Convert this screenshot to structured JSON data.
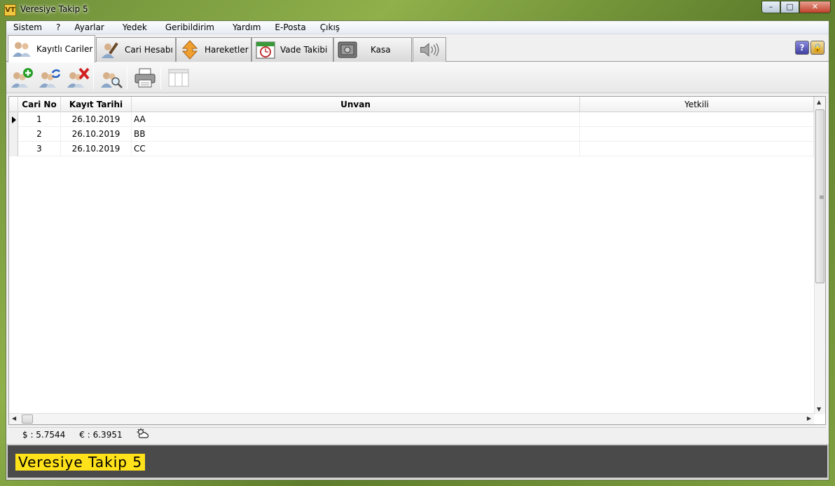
{
  "window": {
    "title": "Veresiye Takip 5",
    "app_icon": "VT",
    "minimize": "–",
    "maximize": "□",
    "close": "✕"
  },
  "menu": [
    "Sistem",
    "?",
    "Ayarlar",
    "Yedek",
    "Geribildirim",
    "Yardım",
    "E-Posta",
    "Çıkış"
  ],
  "tabs": [
    {
      "label": "Kayıtlı Cariler",
      "icon": "users-icon",
      "active": true
    },
    {
      "label": "Cari Hesabı",
      "icon": "pen-user-icon"
    },
    {
      "label": "Hareketler",
      "icon": "up-down-arrows-icon"
    },
    {
      "label": "Vade Takibi",
      "icon": "calendar-clock-icon"
    },
    {
      "label": "Kasa",
      "icon": "safe-icon"
    },
    {
      "label": "",
      "icon": "speaker-icon"
    }
  ],
  "help": {
    "question": "?",
    "lock": "🔒"
  },
  "grid": {
    "columns": [
      "Cari No",
      "Kayıt Tarihi",
      "Unvan",
      "Yetkili"
    ],
    "rows": [
      {
        "no": "1",
        "date": "26.10.2019",
        "unvan": "AA",
        "yetkili": ""
      },
      {
        "no": "2",
        "date": "26.10.2019",
        "unvan": "BB",
        "yetkili": ""
      },
      {
        "no": "3",
        "date": "26.10.2019",
        "unvan": "CC",
        "yetkili": ""
      }
    ]
  },
  "status": {
    "usd": "$ : 5.7544",
    "eur": "€ : 6.3951",
    "weather_icon": "weather-icon"
  },
  "banner": {
    "text": "Veresiye Takip 5"
  },
  "colors": {
    "banner_bg": "#4a4a4a",
    "banner_text_bg": "#ffe21a",
    "close_red": "#c0402a"
  }
}
